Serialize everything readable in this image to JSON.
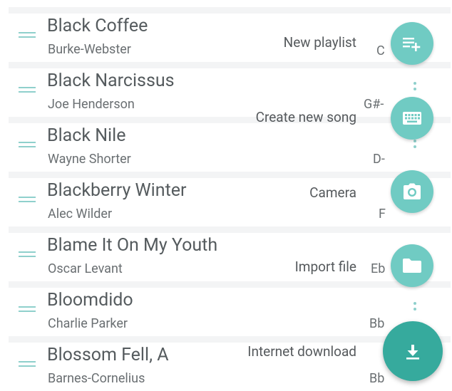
{
  "songs": [
    {
      "title": "Black Coffee",
      "artist": "Burke-Webster",
      "key": "C"
    },
    {
      "title": "Black Narcissus",
      "artist": "Joe Henderson",
      "key": "G#-"
    },
    {
      "title": "Black Nile",
      "artist": "Wayne Shorter",
      "key": "D-"
    },
    {
      "title": "Blackberry Winter",
      "artist": "Alec Wilder",
      "key": "F"
    },
    {
      "title": "Blame It On My Youth",
      "artist": "Oscar Levant",
      "key": "Eb"
    },
    {
      "title": "Bloomdido",
      "artist": "Charlie Parker",
      "key": "Bb"
    },
    {
      "title": "Blossom Fell, A",
      "artist": "Barnes-Cornelius",
      "key": "Bb"
    }
  ],
  "fab_menu": {
    "new_playlist": "New playlist",
    "create_song": "Create new song",
    "camera": "Camera",
    "import_file": "Import file",
    "internet_download": "Internet download"
  },
  "icons": {
    "new_playlist": "playlist-add-icon",
    "create_song": "keyboard-icon",
    "camera": "camera-icon",
    "import_file": "folder-icon",
    "internet_download": "download-icon",
    "drag": "drag-handle-icon"
  },
  "colors": {
    "fab_small": "#70cbc3",
    "fab_main": "#36aa9d",
    "accent_light": "#8fd0cc"
  }
}
